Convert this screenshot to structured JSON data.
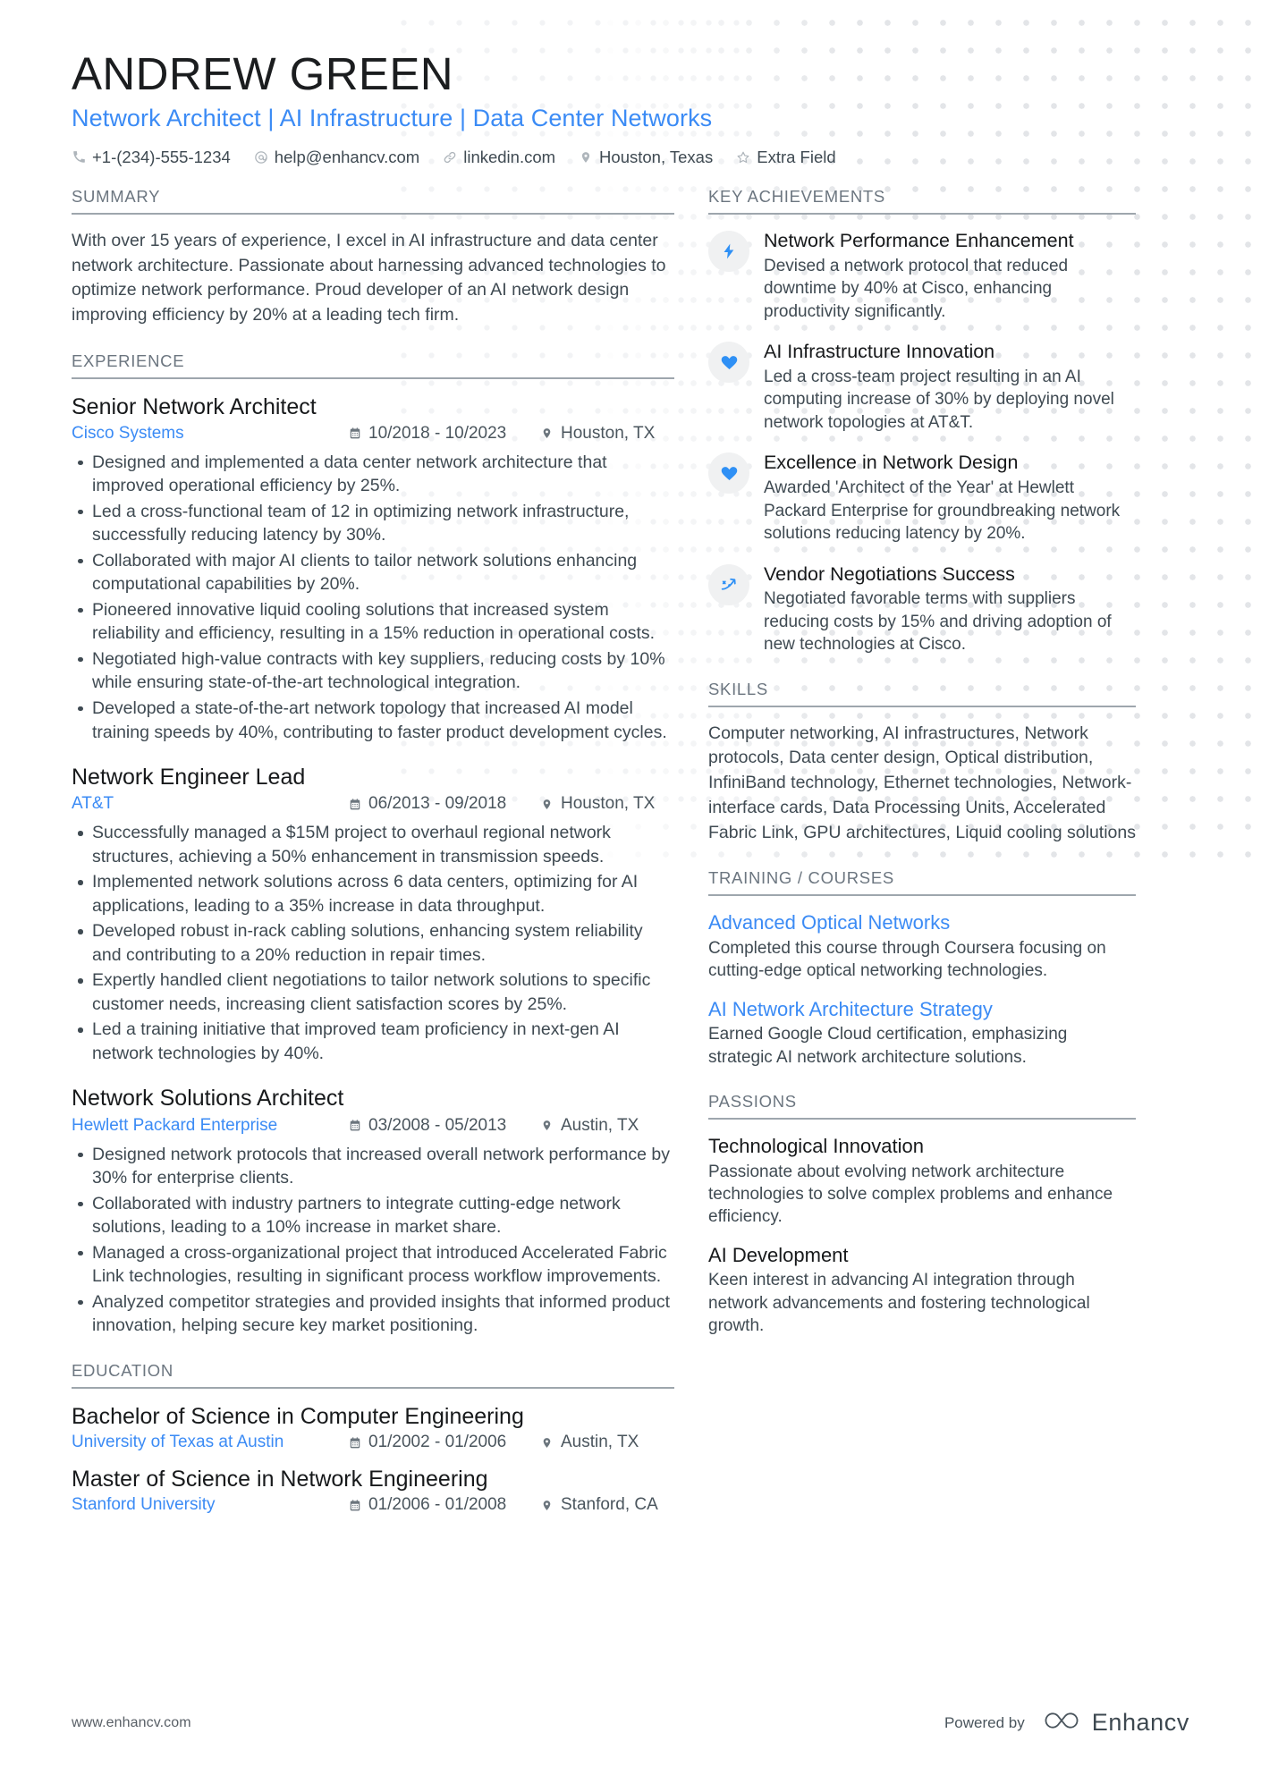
{
  "header": {
    "name": "ANDREW GREEN",
    "headline": "Network Architect | AI Infrastructure | Data Center Networks",
    "contacts": [
      {
        "icon": "phone-icon",
        "text": "+1-(234)-555-1234"
      },
      {
        "icon": "email-icon",
        "text": "help@enhancv.com"
      },
      {
        "icon": "link-icon",
        "text": "linkedin.com"
      },
      {
        "icon": "location-pin-icon",
        "text": "Houston, Texas"
      },
      {
        "icon": "star-icon",
        "text": "Extra Field"
      }
    ]
  },
  "summary": {
    "heading": "SUMMARY",
    "text": "With over 15 years of experience, I excel in AI infrastructure and data center network architecture. Passionate about harnessing advanced technologies to optimize network performance. Proud developer of an AI network design improving efficiency by 20% at a leading tech firm."
  },
  "experience": {
    "heading": "EXPERIENCE",
    "jobs": [
      {
        "title": "Senior Network Architect",
        "company": "Cisco Systems",
        "dates": "10/2018 - 10/2023",
        "location": "Houston, TX",
        "bullets": [
          "Designed and implemented a data center network architecture that improved operational efficiency by 25%.",
          "Led a cross-functional team of 12 in optimizing network infrastructure, successfully reducing latency by 30%.",
          "Collaborated with major AI clients to tailor network solutions enhancing computational capabilities by 20%.",
          "Pioneered innovative liquid cooling solutions that increased system reliability and efficiency, resulting in a 15% reduction in operational costs.",
          "Negotiated high-value contracts with key suppliers, reducing costs by 10% while ensuring state-of-the-art technological integration.",
          "Developed a state-of-the-art network topology that increased AI model training speeds by 40%, contributing to faster product development cycles."
        ]
      },
      {
        "title": "Network Engineer Lead",
        "company": "AT&T",
        "dates": "06/2013 - 09/2018",
        "location": "Houston, TX",
        "bullets": [
          "Successfully managed a $15M project to overhaul regional network structures, achieving a 50% enhancement in transmission speeds.",
          "Implemented network solutions across 6 data centers, optimizing for AI applications, leading to a 35% increase in data throughput.",
          "Developed robust in-rack cabling solutions, enhancing system reliability and contributing to a 20% reduction in repair times.",
          "Expertly handled client negotiations to tailor network solutions to specific customer needs, increasing client satisfaction scores by 25%.",
          "Led a training initiative that improved team proficiency in next-gen AI network technologies by 40%."
        ]
      },
      {
        "title": "Network Solutions Architect",
        "company": "Hewlett Packard Enterprise",
        "dates": "03/2008 - 05/2013",
        "location": "Austin, TX",
        "bullets": [
          "Designed network protocols that increased overall network performance by 30% for enterprise clients.",
          "Collaborated with industry partners to integrate cutting-edge network solutions, leading to a 10% increase in market share.",
          "Managed a cross-organizational project that introduced Accelerated Fabric Link technologies, resulting in significant process workflow improvements.",
          "Analyzed competitor strategies and provided insights that informed product innovation, helping secure key market positioning."
        ]
      }
    ]
  },
  "education": {
    "heading": "EDUCATION",
    "entries": [
      {
        "degree": "Bachelor of Science in Computer Engineering",
        "school": "University of Texas at Austin",
        "dates": "01/2002 - 01/2006",
        "location": "Austin, TX"
      },
      {
        "degree": "Master of Science in Network Engineering",
        "school": "Stanford University",
        "dates": "01/2006 - 01/2008",
        "location": "Stanford, CA"
      }
    ]
  },
  "achievements": {
    "heading": "KEY ACHIEVEMENTS",
    "items": [
      {
        "icon": "lightning-bolt-icon",
        "title": "Network Performance Enhancement",
        "desc": "Devised a network protocol that reduced downtime by 40% at Cisco, enhancing productivity significantly."
      },
      {
        "icon": "heart-icon",
        "title": "AI Infrastructure Innovation",
        "desc": "Led a cross-team project resulting in an AI computing increase of 30% by deploying novel network topologies at AT&T."
      },
      {
        "icon": "heart-icon",
        "title": "Excellence in Network Design",
        "desc": "Awarded 'Architect of the Year' at Hewlett Packard Enterprise for groundbreaking network solutions reducing latency by 20%."
      },
      {
        "icon": "trending-arrow-icon",
        "title": "Vendor Negotiations Success",
        "desc": "Negotiated favorable terms with suppliers reducing costs by 15% and driving adoption of new technologies at Cisco."
      }
    ]
  },
  "skills": {
    "heading": "SKILLS",
    "text": "Computer networking, AI infrastructures, Network protocols, Data center design, Optical distribution, InfiniBand technology, Ethernet technologies, Network-interface cards, Data Processing Units, Accelerated Fabric Link, GPU architectures, Liquid cooling solutions"
  },
  "training": {
    "heading": "TRAINING / COURSES",
    "items": [
      {
        "title": "Advanced Optical Networks",
        "desc": "Completed this course through Coursera focusing on cutting-edge optical networking technologies."
      },
      {
        "title": "AI Network Architecture Strategy",
        "desc": "Earned Google Cloud certification, emphasizing strategic AI network architecture solutions."
      }
    ]
  },
  "passions": {
    "heading": "PASSIONS",
    "items": [
      {
        "title": "Technological Innovation",
        "desc": "Passionate about evolving network architecture technologies to solve complex problems and enhance efficiency."
      },
      {
        "title": "AI Development",
        "desc": "Keen interest in advancing AI integration through network advancements and fostering technological growth."
      }
    ]
  },
  "footer": {
    "url": "www.enhancv.com",
    "powered_by": "Powered by",
    "brand": "Enhancv"
  },
  "colors": {
    "accent_blue": "#3b8bf5",
    "icon_blue": "#2f90f5",
    "text_dark": "#17191b",
    "text_body": "#3f4a52",
    "heading_gray": "#6c7680"
  }
}
